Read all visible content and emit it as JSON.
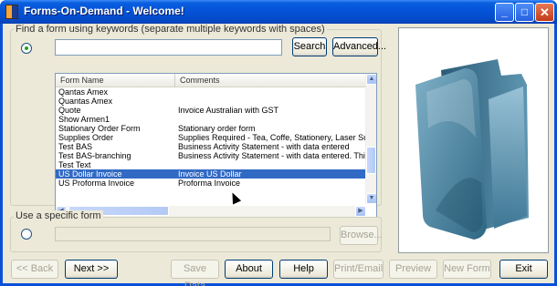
{
  "window": {
    "title": "Forms-On-Demand - Welcome!"
  },
  "titlebar_buttons": {
    "minimize": "_",
    "maximize": "□",
    "close": "✕"
  },
  "keyword_group": {
    "label": "Find a form using keywords (separate multiple keywords with spaces)",
    "search_value": "",
    "search_button": "Search",
    "advanced_button": "Advanced..."
  },
  "form_list": {
    "columns": [
      "Form Name",
      "Comments"
    ],
    "rows": [
      {
        "name": "Qantas Amex",
        "comment": ""
      },
      {
        "name": "Quantas Amex",
        "comment": ""
      },
      {
        "name": "Quote",
        "comment": "Invoice Australian with GST"
      },
      {
        "name": "Show Armen1",
        "comment": ""
      },
      {
        "name": "Stationary Order Form",
        "comment": "Stationary order form"
      },
      {
        "name": "Supplies Order",
        "comment": "Supplies Required - Tea, Coffe, Stationery, Laser Supplies"
      },
      {
        "name": "Test BAS",
        "comment": "Business Activity Statement - with data entered"
      },
      {
        "name": "Test BAS-branching",
        "comment": "Business Activity Statement - with data entered.  This we're u"
      },
      {
        "name": "Test Text",
        "comment": ""
      },
      {
        "name": "US Dollar Invoice",
        "comment": "Invoice US Dollar"
      },
      {
        "name": "US Proforma Invoice",
        "comment": "Proforma Invoice"
      }
    ],
    "selected_index": 9
  },
  "specific_group": {
    "label": "Use a specific form",
    "path_value": "",
    "browse_button": "Browse..."
  },
  "bottom_buttons": {
    "back": "<< Back",
    "next": "Next >>",
    "save_data": "Save Data",
    "about": "About",
    "help": "Help",
    "print_email": "Print/Email",
    "preview": "Preview",
    "new_form": "New Form",
    "exit": "Exit"
  },
  "colors": {
    "titlebar": "#0452d6",
    "selection": "#316ac5",
    "window_face": "#ece9d8",
    "folder": "#3e7a9a"
  },
  "icons": [
    "app-icon",
    "folder-icon",
    "mouse-cursor-icon"
  ]
}
